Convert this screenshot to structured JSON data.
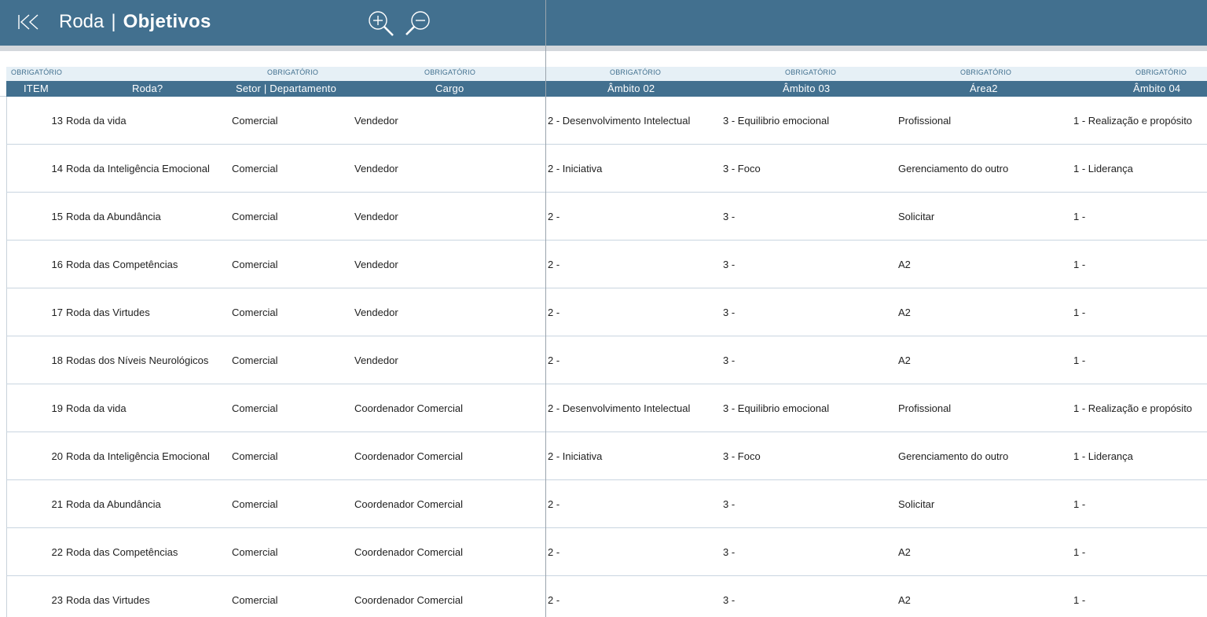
{
  "header": {
    "title_light": "Roda",
    "separator": "|",
    "title_bold": "Objetivos",
    "icons": {
      "back": "skip-back-icon",
      "zoom_in": "zoom-in-icon",
      "zoom_out": "zoom-out-icon"
    }
  },
  "colors": {
    "header_bg": "#42708f",
    "required_bg": "#e6f0f6",
    "strip": "#d3d7dc"
  },
  "required_labels": [
    "OBRIGATÓRIO",
    "OBRIGATÓRIO",
    "OBRIGATÓRIO",
    "OBRIGATÓRIO",
    "OBRIGATÓRIO",
    "OBRIGATÓRIO",
    "OBRIGATÓRIO"
  ],
  "columns": [
    "ITEM",
    "Roda?",
    "Setor | Departamento",
    "Cargo",
    "Âmbito 02",
    "Âmbito 03",
    "Área2",
    "Âmbito 04"
  ],
  "rows": [
    {
      "item": "13",
      "roda": "Roda da vida",
      "setor": "Comercial",
      "cargo": "Vendedor",
      "ambito02": "2 - Desenvolvimento Intelectual",
      "ambito03": "3 - Equilibrio emocional",
      "area2": "Profissional",
      "ambito04": "1 - Realização e propósito"
    },
    {
      "item": "14",
      "roda": "Roda da Inteligência Emocional",
      "setor": "Comercial",
      "cargo": "Vendedor",
      "ambito02": "2 - Iniciativa",
      "ambito03": "3 - Foco",
      "area2": "Gerenciamento do outro",
      "ambito04": "1 - Liderança"
    },
    {
      "item": "15",
      "roda": "Roda da Abundância",
      "setor": "Comercial",
      "cargo": "Vendedor",
      "ambito02": "2 -",
      "ambito03": "3 -",
      "area2": "Solicitar",
      "ambito04": "1 -"
    },
    {
      "item": "16",
      "roda": "Roda das Competências",
      "setor": "Comercial",
      "cargo": "Vendedor",
      "ambito02": "2 -",
      "ambito03": "3 -",
      "area2": "A2",
      "ambito04": "1 -"
    },
    {
      "item": "17",
      "roda": "Roda das Virtudes",
      "setor": "Comercial",
      "cargo": "Vendedor",
      "ambito02": "2 -",
      "ambito03": "3 -",
      "area2": "A2",
      "ambito04": "1 -"
    },
    {
      "item": "18",
      "roda": "Rodas dos Níveis Neurológicos",
      "setor": "Comercial",
      "cargo": "Vendedor",
      "ambito02": "2 -",
      "ambito03": "3 -",
      "area2": "A2",
      "ambito04": "1 -"
    },
    {
      "item": "19",
      "roda": "Roda da vida",
      "setor": "Comercial",
      "cargo": "Coordenador Comercial",
      "ambito02": "2 - Desenvolvimento Intelectual",
      "ambito03": "3 - Equilibrio emocional",
      "area2": "Profissional",
      "ambito04": "1 - Realização e propósito"
    },
    {
      "item": "20",
      "roda": "Roda da Inteligência Emocional",
      "setor": "Comercial",
      "cargo": "Coordenador Comercial",
      "ambito02": "2 - Iniciativa",
      "ambito03": "3 - Foco",
      "area2": "Gerenciamento do outro",
      "ambito04": "1 - Liderança"
    },
    {
      "item": "21",
      "roda": "Roda da Abundância",
      "setor": "Comercial",
      "cargo": "Coordenador Comercial",
      "ambito02": "2 -",
      "ambito03": "3 -",
      "area2": "Solicitar",
      "ambito04": "1 -"
    },
    {
      "item": "22",
      "roda": "Roda das Competências",
      "setor": "Comercial",
      "cargo": "Coordenador Comercial",
      "ambito02": "2 -",
      "ambito03": "3 -",
      "area2": "A2",
      "ambito04": "1 -"
    },
    {
      "item": "23",
      "roda": "Roda das Virtudes",
      "setor": "Comercial",
      "cargo": "Coordenador Comercial",
      "ambito02": "2 -",
      "ambito03": "3 -",
      "area2": "A2",
      "ambito04": "1 -"
    }
  ]
}
